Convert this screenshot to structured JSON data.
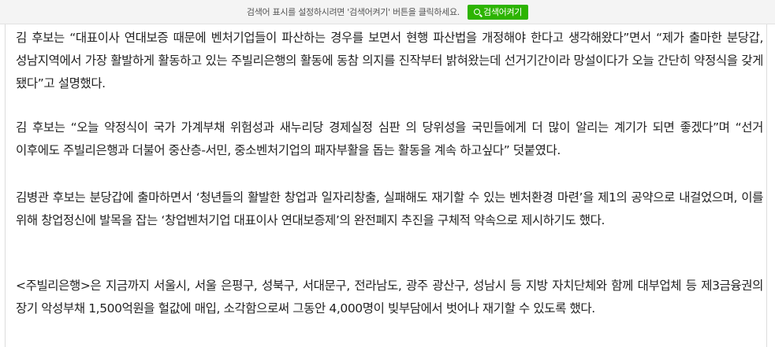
{
  "search_bar": {
    "message": "검색어 표시를 설정하시려면 '검색어켜기' 버튼을 클릭하세요.",
    "button_label": "검색어켜기",
    "button_color": "#2db400",
    "button_icon": "search-icon"
  },
  "article": {
    "paragraphs": [
      "김 후보는 “대표이사 연대보증 때문에 벤처기업들이 파산하는 경우를 보면서 현행 파산법을 개정해야 한다고 생각해왔다”면서 “제가 출마한 분당갑, 성남지역에서 가장 활발하게 활동하고 있는 주빌리은행의 활동에 동참 의지를 진작부터 밝혀왔는데 선거기간이라 망설이다가 오늘 간단히 약정식을 갖게 됐다”고 설명했다.",
      "김 후보는 “오늘 약정식이 국가 가계부채 위험성과 새누리당 경제실정 심판 의 당위성을 국민들에게 더 많이 알리는 계기가 되면 좋겠다”며 “선거 이후에도 주빌리은행과 더불어 중산층-서민, 중소벤처기업의 패자부활을 돕는 활동을 계속 하고싶다” 덧붙였다.",
      "김병관 후보는 분당갑에 출마하면서 ‘청년들의 활발한 창업과 일자리창출, 실패해도 재기할 수 있는 벤처환경 마련’을 제1의 공약으로 내걸었으며, 이를 위해 창업정신에 발목을 잡는 ‘창업벤처기업 대표이사 연대보증제’의 완전폐지 추진을 구체적 약속으로 제시하기도 했다.",
      "<주빌리은행>은 지금까지 서울시, 서울 은평구, 성북구, 서대문구, 전라남도, 광주 광산구, 성남시 등 지방 자치단체와 함께 대부업체 등 제3금융권의 장기 악성부채 1,500억원을 헐값에 매입, 소각함으로써 그동안 4,000명이 빚부담에서 벗어나 재기할 수 있도록 했다."
    ]
  }
}
